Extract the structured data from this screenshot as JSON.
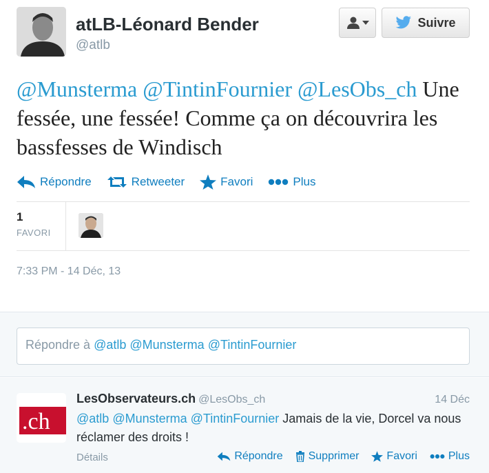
{
  "tweet": {
    "author_name": "atLB-Léonard Bender",
    "author_handle": "@atlb",
    "follow_label": "Suivre",
    "text_parts": {
      "mention_1": "@Munsterma",
      "mention_2": "@TintinFournier",
      "mention_3": "@LesObs_ch",
      "body": " Une fessée, une fessée! Comme ça on découvrira les bassfesses de Windisch"
    },
    "actions": {
      "reply": "Répondre",
      "retweet": "Retweeter",
      "favorite": "Favori",
      "more": "Plus"
    },
    "favorites_count": "1",
    "favorites_label": "FAVORI",
    "timestamp": "7:33 PM - 14 Déc, 13"
  },
  "reply_box": {
    "prefix": "Répondre à ",
    "mention_1": "@atlb",
    "mention_2": "@Munsterma",
    "mention_3": "@TintinFournier"
  },
  "reply_tweet": {
    "author_name": "LesObservateurs.ch",
    "author_handle": "@LesObs_ch",
    "date": "14 Déc",
    "mention_1": "@atlb",
    "mention_2": "@Munsterma",
    "mention_3": "@TintinFournier",
    "body": " Jamais de la vie, Dorcel va nous réclamer des droits !",
    "avatar_text": ".ch",
    "details_label": "Détails",
    "actions": {
      "reply": "Répondre",
      "delete": "Supprimer",
      "favorite": "Favori",
      "more": "Plus"
    }
  },
  "colors": {
    "link": "#2a9bd0",
    "action": "#0f7ebf",
    "muted": "#8899a6",
    "twitter_blue": "#55acee",
    "obs_red": "#c8102e"
  }
}
